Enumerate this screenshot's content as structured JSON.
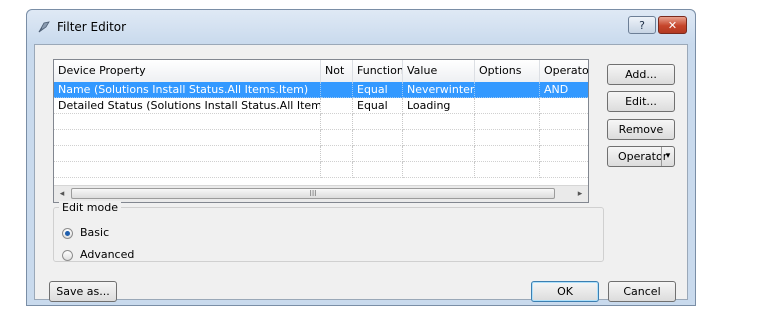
{
  "window": {
    "title": "Filter Editor",
    "help_label": "?",
    "close_label": "✕"
  },
  "grid": {
    "columns": [
      "Device Property",
      "Not",
      "Function",
      "Value",
      "Options",
      "Operator"
    ],
    "rows": [
      {
        "property": "Name (Solutions Install Status.All Items.Item)",
        "not": "",
        "function": "Equal",
        "value": "Neverwinter",
        "options": "",
        "operator": "AND",
        "selected": true
      },
      {
        "property": "Detailed Status (Solutions Install Status.All Items.Item)",
        "not": "",
        "function": "Equal",
        "value": "Loading",
        "options": "",
        "operator": "",
        "selected": false
      }
    ],
    "scroll_left": "◂",
    "scroll_right": "▸",
    "scroll_thumb_grip": "III"
  },
  "buttons": {
    "add": "Add...",
    "edit": "Edit...",
    "remove": "Remove",
    "operator": "Operator",
    "operator_arrow": "▾",
    "save_as": "Save as...",
    "ok": "OK",
    "cancel": "Cancel"
  },
  "edit_mode": {
    "legend": "Edit mode",
    "options": [
      {
        "label": "Basic",
        "checked": true
      },
      {
        "label": "Advanced",
        "checked": false
      }
    ]
  },
  "colors": {
    "selection": "#3399ff",
    "frame": "#c9daed",
    "close": "#c6452b"
  }
}
